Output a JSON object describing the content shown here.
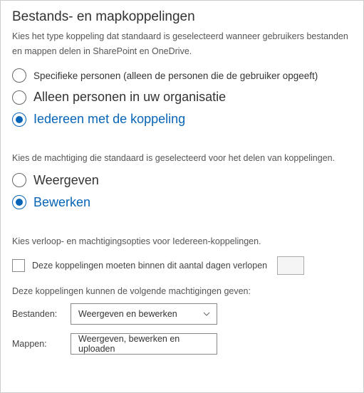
{
  "title": "Bestands- en mapkoppelingen",
  "intro": "Kies het type koppeling dat standaard is geselecteerd wanneer gebruikers bestanden en mappen delen in SharePoint en OneDrive.",
  "link_type": {
    "options": [
      {
        "label": "Specifieke personen (alleen de personen die de gebruiker opgeeft)",
        "selected": false
      },
      {
        "label": "Alleen personen in uw organisatie",
        "selected": false
      },
      {
        "label": "Iedereen met de koppeling",
        "selected": true
      }
    ]
  },
  "perm_intro": "Kies de machtiging die standaard is geselecteerd voor het delen van koppelingen.",
  "permission": {
    "options": [
      {
        "label": "Weergeven",
        "selected": false
      },
      {
        "label": "Bewerken",
        "selected": true
      }
    ]
  },
  "expiry_intro": "Kies verloop- en machtigingsopties voor Iedereen-koppelingen.",
  "expiry": {
    "checked": false,
    "label": "Deze koppelingen moeten binnen dit aantal dagen verlopen",
    "value": ""
  },
  "grants_intro": "Deze koppelingen kunnen de volgende machtigingen geven:",
  "files": {
    "label": "Bestanden:",
    "value": "Weergeven en bewerken"
  },
  "folders": {
    "label": "Mappen:",
    "value": "Weergeven, bewerken en uploaden"
  }
}
